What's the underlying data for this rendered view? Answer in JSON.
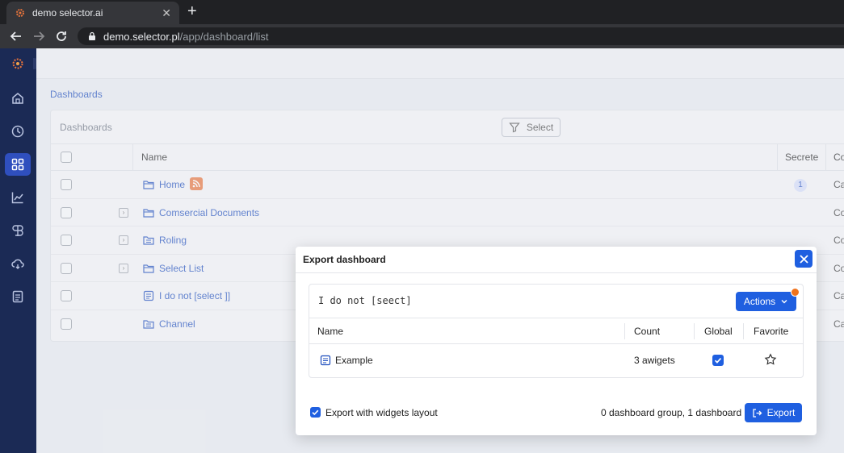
{
  "browser": {
    "tab_title": "demo selector.ai",
    "new_tab_symbol": "+",
    "url_host": "demo.selector.pl",
    "url_path": "/app/dashboard/list"
  },
  "sidebar": {
    "items": [
      {
        "icon": "home-icon"
      },
      {
        "icon": "clock-icon"
      },
      {
        "icon": "grid-icon",
        "active": true
      },
      {
        "icon": "chart-icon"
      },
      {
        "icon": "brain-icon"
      },
      {
        "icon": "cloud-icon"
      },
      {
        "icon": "document-icon"
      }
    ]
  },
  "breadcrumb": "Dashboards",
  "panel": {
    "title": "Dashboards",
    "select_label": "Select",
    "columns": {
      "name": "Name",
      "secrete": "Secrete",
      "co": "Co"
    },
    "rows": [
      {
        "name": "Home",
        "co": "Ca",
        "badge": "1"
      },
      {
        "name": "Comsercial Documents",
        "co": "Co"
      },
      {
        "name": "Roling",
        "co": "Co"
      },
      {
        "name": "Select List",
        "co": "Co"
      },
      {
        "name": "I do not [select ]]",
        "co": "Ca"
      },
      {
        "name": "Channel",
        "co": "Ca"
      }
    ]
  },
  "modal": {
    "title": "Export dashboard",
    "item_name": "I do not [seect]",
    "actions_label": "Actions",
    "columns": {
      "name": "Name",
      "count": "Count",
      "global": "Global",
      "favorite": "Favorite"
    },
    "row": {
      "name": "Example",
      "count": "3 awigets"
    },
    "export_layout_label": "Export with widgets layout",
    "summary": "0 dashboard group, 1 dashboard",
    "export_label": "Export"
  },
  "colors": {
    "accent": "#1f5fe0",
    "sidebar": "#1b2a55",
    "link": "#1c4cbd",
    "notification": "#f0731d"
  }
}
